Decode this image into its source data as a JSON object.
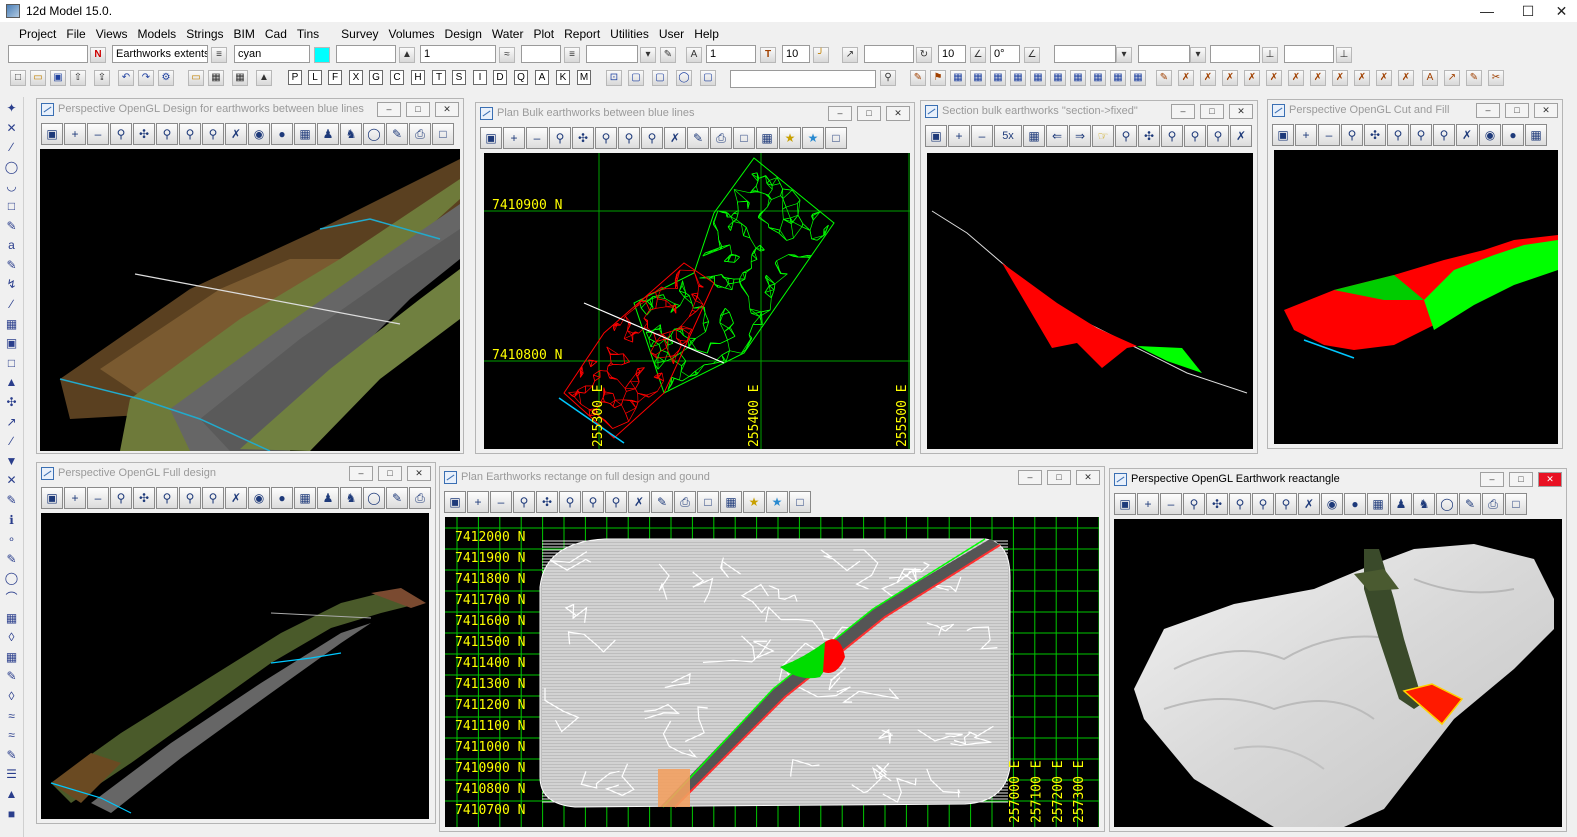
{
  "app": {
    "title": "12d Model  15.0."
  },
  "menu": [
    "Project",
    "File",
    "Views",
    "Models",
    "Strings",
    "BIM",
    "Cad",
    "Tins",
    "Survey",
    "Volumes",
    "Design",
    "Water",
    "Plot",
    "Report",
    "Utilities",
    "User",
    "Help"
  ],
  "toolbar1": {
    "model_label": "N",
    "model_name": "Earthworks extents",
    "colour": "cyan",
    "colour_hex": "#00ffff",
    "weight": "1",
    "text_weight": "1",
    "text_size": "10",
    "slope_value": "10",
    "angle_value": "0°"
  },
  "toolbar2": {
    "letters": [
      "P",
      "L",
      "F",
      "X",
      "G",
      "C",
      "H",
      "T",
      "S",
      "I",
      "D",
      "Q",
      "A",
      "K",
      "M"
    ]
  },
  "views": {
    "v1": {
      "title": "Perspective OpenGL Design for earthworks between blue lines"
    },
    "v2": {
      "title": "Plan Bulk earthworks between blue lines",
      "north1": "7410900 N",
      "north2": "7410800 N",
      "east1": "255400 E",
      "east2": "255500 E",
      "east0": "255300 E"
    },
    "v3": {
      "title": "Section bulk earthworks \"section->fixed\"",
      "zoom": "5x"
    },
    "v4": {
      "title": "Perspective OpenGL Cut and Fill"
    },
    "v5": {
      "title": "Perspective OpenGL Full design"
    },
    "v6": {
      "title": "Plan Earthworks rectange on full design and gound",
      "northings": [
        "7412000 N",
        "7411900 N",
        "7411800 N",
        "7411700 N",
        "7411600 N",
        "7411500 N",
        "7411400 N",
        "7411300 N",
        "7411200 N",
        "7411100 N",
        "7411000 N",
        "7410900 N",
        "7410800 N",
        "7410700 N"
      ],
      "eastings": [
        "257000 E",
        "257100 E",
        "257200 E",
        "257300 E"
      ]
    },
    "v7": {
      "title": "Perspective OpenGL Earthwork reactangle"
    }
  },
  "colors": {
    "cut": "#ff0000",
    "fill": "#00ff00",
    "grid": "#00c800",
    "label": "#ffff00",
    "boundary": "#00c8ff"
  }
}
